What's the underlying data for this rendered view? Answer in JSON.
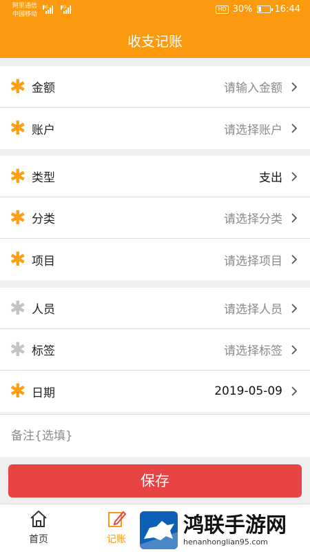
{
  "status_bar": {
    "carrier_1": "阿里通信",
    "carrier_2": "中国移动",
    "network_1": "3G",
    "network_2": "4G",
    "hd": "HD",
    "battery_percent": "30%",
    "battery_level": 0.3,
    "time": "16:44"
  },
  "header": {
    "title": "收支记账"
  },
  "sections": [
    {
      "rows": [
        {
          "label": "金额",
          "value": "请输入金额",
          "required": true,
          "filled": false
        },
        {
          "label": "账户",
          "value": "请选择账户",
          "required": true,
          "filled": false
        }
      ]
    },
    {
      "rows": [
        {
          "label": "类型",
          "value": "支出",
          "required": true,
          "filled": true
        },
        {
          "label": "分类",
          "value": "请选择分类",
          "required": true,
          "filled": false
        },
        {
          "label": "项目",
          "value": "请选择项目",
          "required": true,
          "filled": false
        }
      ]
    },
    {
      "rows": [
        {
          "label": "人员",
          "value": "请选择人员",
          "required": false,
          "filled": false
        },
        {
          "label": "标签",
          "value": "请选择标签",
          "required": false,
          "filled": false
        },
        {
          "label": "日期",
          "value": "2019-05-09",
          "required": true,
          "filled": true
        }
      ]
    }
  ],
  "star_symbol": "✱",
  "remark": {
    "placeholder": "备注{选填}",
    "value": ""
  },
  "save_label": "保存",
  "tabbar": {
    "home_label": "首页",
    "ledger_label": "记账"
  },
  "watermark": {
    "title": "鸿联手游网",
    "url": "henanhonglian95.com"
  },
  "colors": {
    "brand_orange": "#fc9a0f",
    "save_red": "#e84444",
    "required_star": "#fca012",
    "optional_star": "#c3c3c3"
  }
}
